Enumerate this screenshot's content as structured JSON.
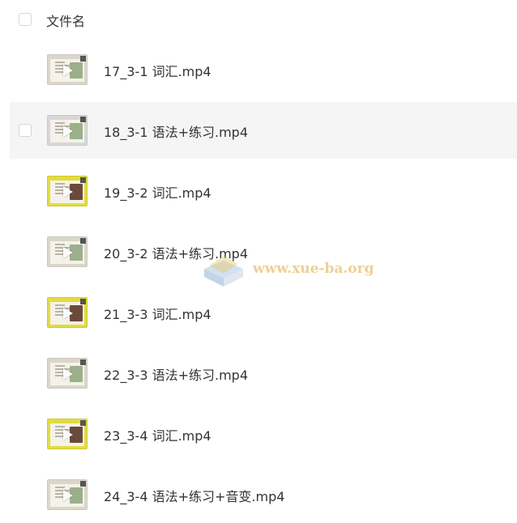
{
  "header": {
    "label": "文件名"
  },
  "files": [
    {
      "name": "17_3-1 词汇.mp4",
      "thumb": "beige",
      "hover": false
    },
    {
      "name": "18_3-1 语法+练习.mp4",
      "thumb": "gray",
      "hover": true
    },
    {
      "name": "19_3-2 词汇.mp4",
      "thumb": "yellow",
      "hover": false
    },
    {
      "name": "20_3-2 语法+练习.mp4",
      "thumb": "beige",
      "hover": false
    },
    {
      "name": "21_3-3 词汇.mp4",
      "thumb": "yellow",
      "hover": false
    },
    {
      "name": "22_3-3 语法+练习.mp4",
      "thumb": "beige",
      "hover": false
    },
    {
      "name": "23_3-4 词汇.mp4",
      "thumb": "yellow",
      "hover": false
    },
    {
      "name": "24_3-4 语法+练习+音变.mp4",
      "thumb": "beige",
      "hover": false
    }
  ],
  "watermark": {
    "text": "www.xue-ba.org",
    "icon": "book-logo-icon"
  },
  "colors": {
    "hover_row": "#f5f5f5",
    "text": "#333333",
    "yellow_thumb": "#e2dc3c",
    "beige_thumb": "#dcd6c6"
  }
}
